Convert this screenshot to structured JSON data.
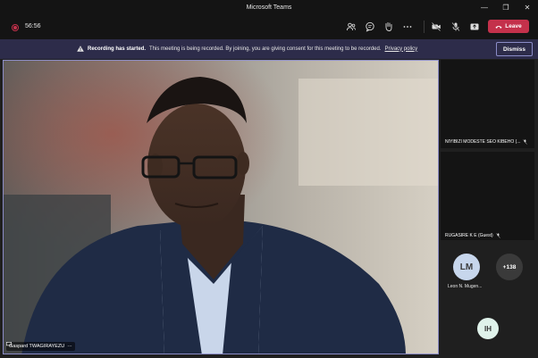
{
  "window": {
    "title": "Microsoft Teams",
    "controls": [
      "minimize-icon",
      "maximize-icon",
      "close-icon"
    ]
  },
  "toolbar": {
    "timer": "56:56",
    "icons": [
      "people-icon",
      "chat-icon",
      "reactions-icon",
      "more-icon",
      "camera-off-icon",
      "mic-off-icon",
      "share-icon"
    ],
    "leave_label": "Leave",
    "colors": {
      "leave": "#c4314b",
      "bar": "#141414"
    }
  },
  "banner": {
    "title": "Recording has started.",
    "message": "This meeting is being recorded. By joining, you are giving consent for this meeting to be recorded.",
    "link": "Privacy policy",
    "dismiss_label": "Dismiss",
    "color": "#2d2c4a"
  },
  "stage": {
    "speaker_name": "Gaspard TWAGIRAYEZU",
    "accent": "#8b8cc7"
  },
  "participants": {
    "tile1_name": "NIYIBIZI MODESTE SEO KIBEHO (...",
    "tile2_name": "RUGASIRE K E (Guest)",
    "avatar1_initials": "LM",
    "avatar1_name": "Leon N. Mugen...",
    "more_count": "+138",
    "avatar2_initials": "IH"
  }
}
